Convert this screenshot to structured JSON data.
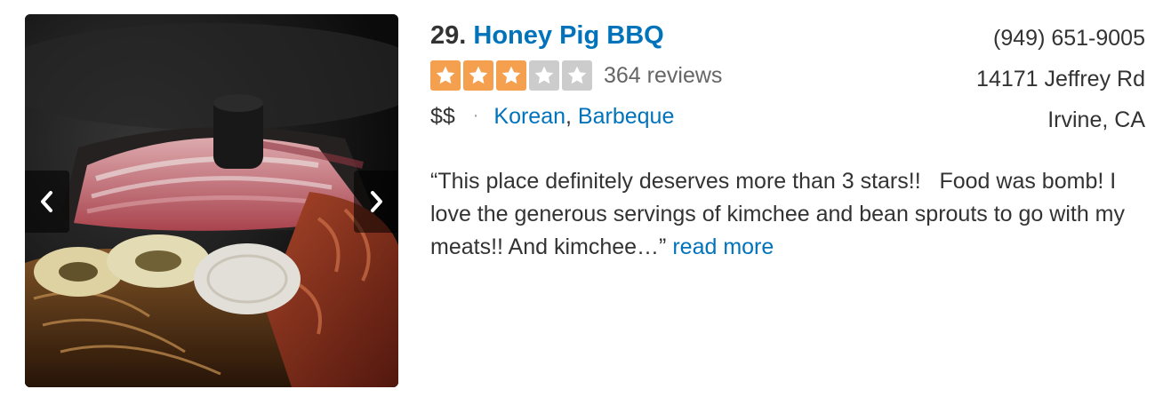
{
  "business": {
    "rank": "29.",
    "name": "Honey Pig BBQ",
    "rating": 3,
    "max_rating": 5,
    "review_count": "364 reviews",
    "price": "$$",
    "separator": "·",
    "categories": [
      "Korean",
      "Barbeque"
    ],
    "category_comma": ","
  },
  "contact": {
    "phone": "(949) 651-9005",
    "address_line1": "14171 Jeffrey Rd",
    "address_line2": "Irvine, CA"
  },
  "snippet": {
    "text": "“This place definitely deserves more than 3 stars!!   Food was bomb! I love the generous servings of kimchee and bean sprouts to go with my meats!! And kimchee…”",
    "read_more": "read more"
  },
  "photo": {
    "subject": "korean-bbq-grill-photo",
    "prev_icon": "chevron-left-icon",
    "next_icon": "chevron-right-icon"
  },
  "colors": {
    "link": "#0073bb",
    "star_filled": "#f5a04f",
    "star_empty": "#cccccc",
    "text": "#333333",
    "muted": "#666666"
  }
}
